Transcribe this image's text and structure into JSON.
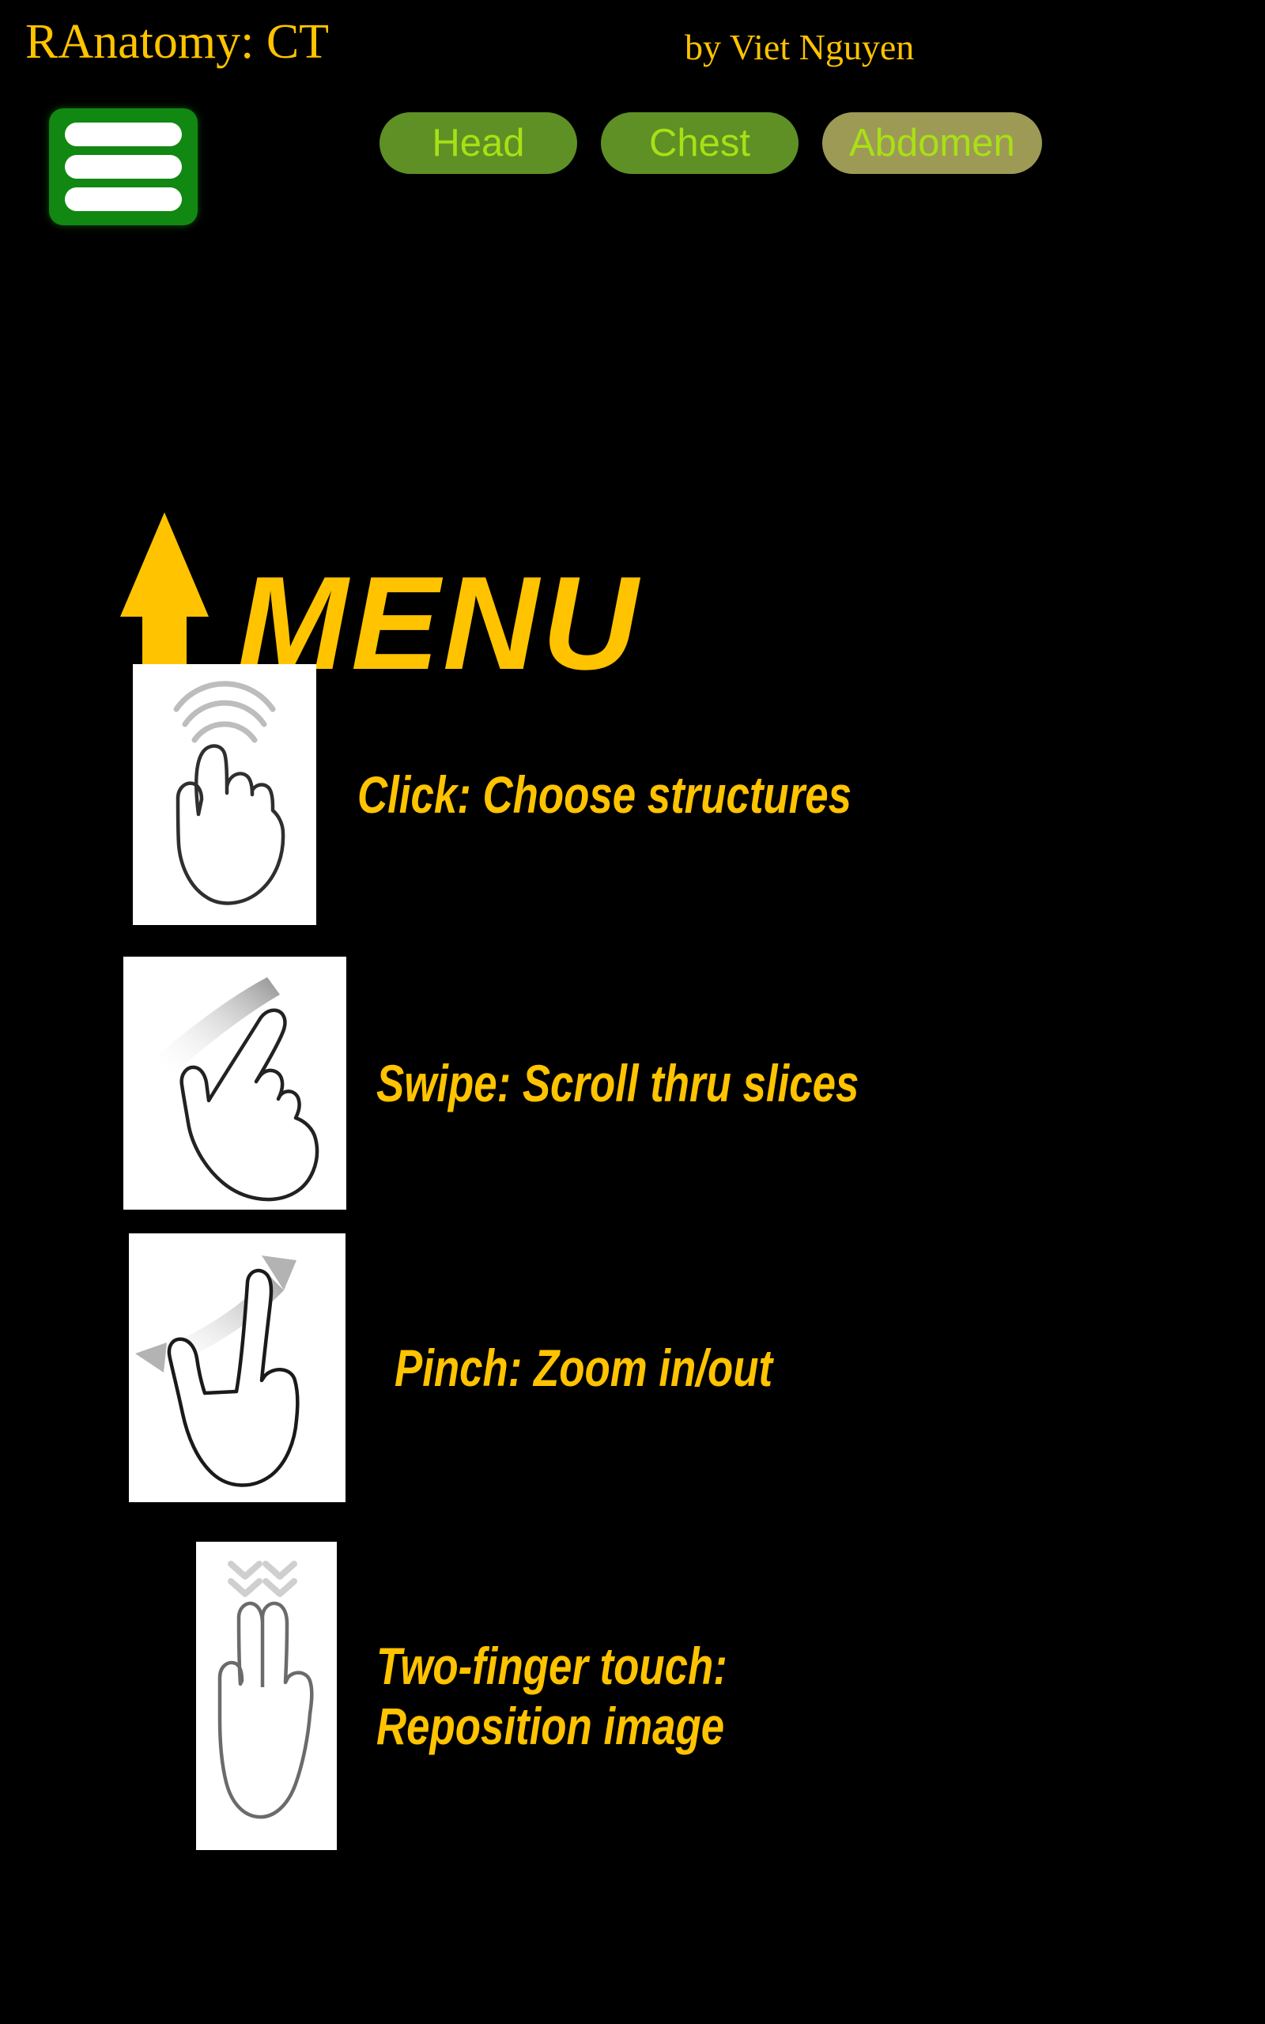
{
  "app": {
    "title": "RAnatomy: CT",
    "author": "by Viet Nguyen",
    "background_color": "#000000",
    "accent_color": "#FFC300"
  },
  "header": {
    "menu_button": {
      "name": "hamburger-menu",
      "icon": "hamburger-icon",
      "background_color": "#118811",
      "bar_color": "#FFFFFF"
    },
    "tabs": [
      {
        "label": "Head",
        "state": "normal",
        "bg": "#5E9025",
        "fg": "#A8E015"
      },
      {
        "label": "Chest",
        "state": "normal",
        "bg": "#5E9025",
        "fg": "#A8E015"
      },
      {
        "label": "Abdomen",
        "state": "active",
        "bg": "#9D9A55",
        "fg": "#A8E015"
      }
    ]
  },
  "callout": {
    "arrow_icon": "arrow-up-icon",
    "arrow_color": "#FFC300",
    "text": "MENU"
  },
  "gestures": [
    {
      "icon": "tap-hand-icon",
      "label": "Click: Choose structures"
    },
    {
      "icon": "swipe-hand-icon",
      "label": "Swipe: Scroll thru slices"
    },
    {
      "icon": "pinch-hand-icon",
      "label": "Pinch: Zoom in/out"
    },
    {
      "icon": "two-finger-hand-icon",
      "label": "Two-finger touch:\nReposition image"
    }
  ]
}
